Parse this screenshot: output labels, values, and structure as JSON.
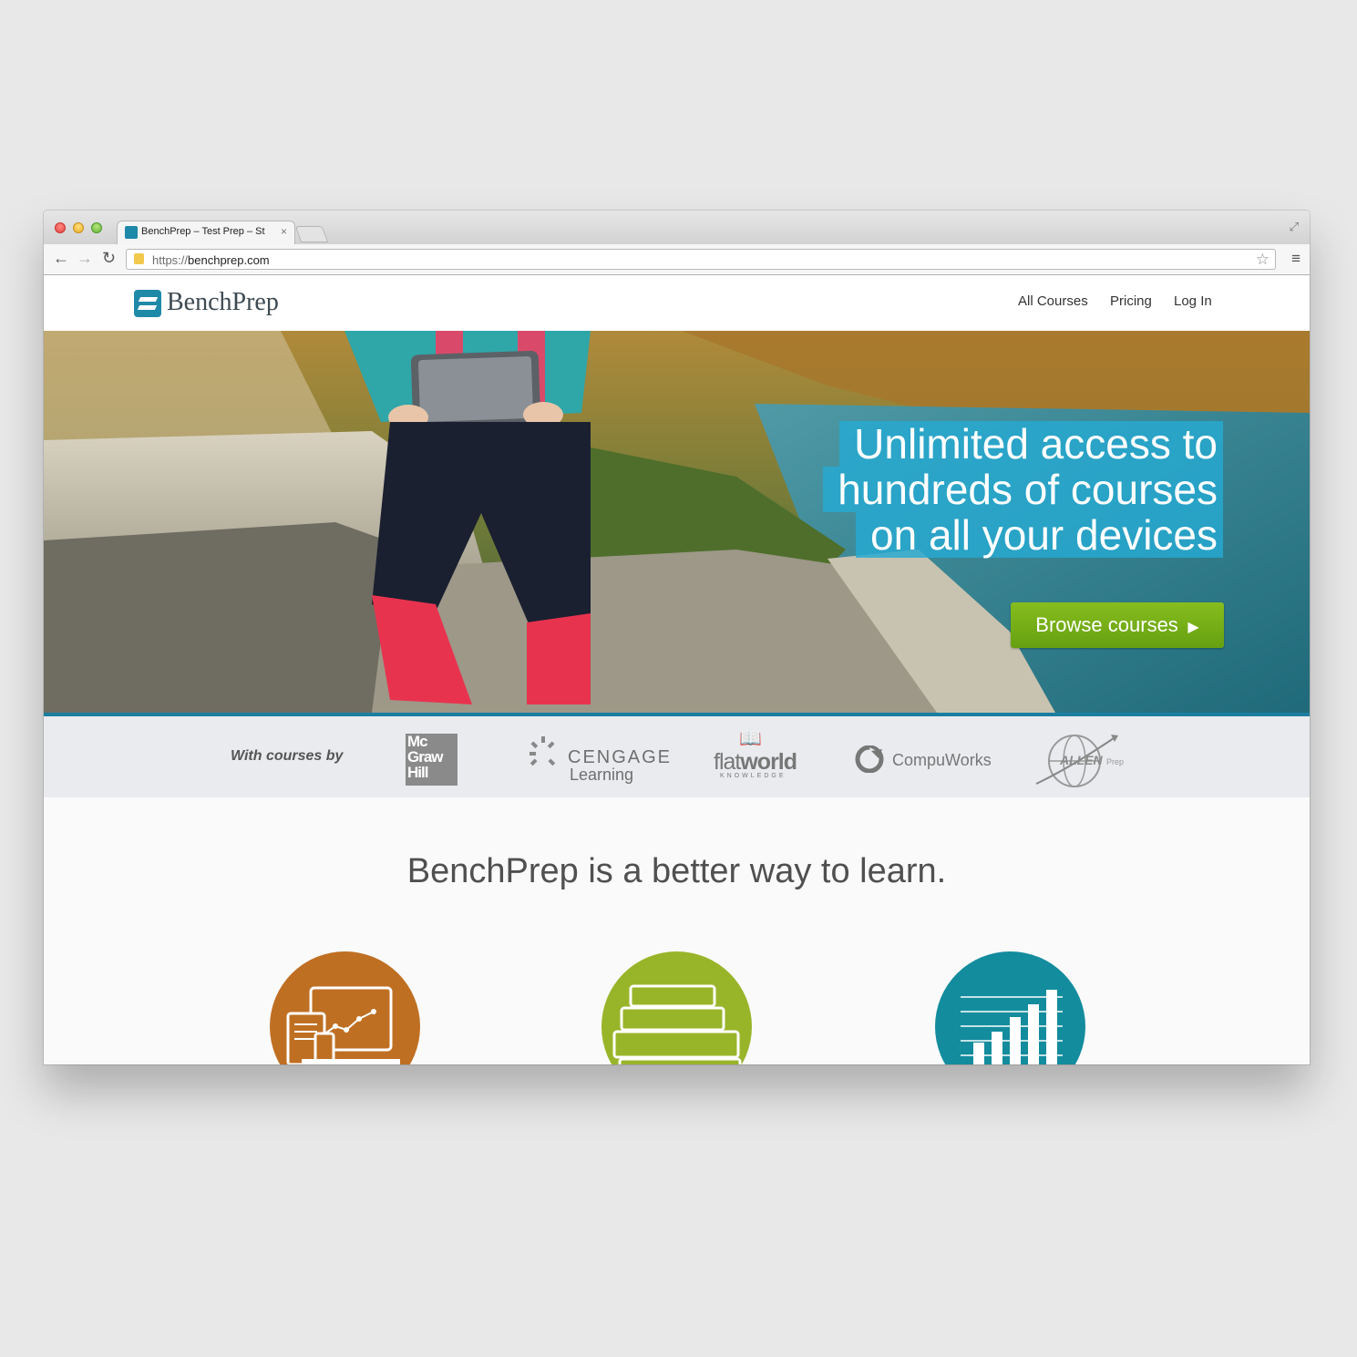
{
  "browser": {
    "tab_title": "BenchPrep – Test Prep – St",
    "tab_close": "×",
    "url_scheme": "https://",
    "url_host": "benchprep.com",
    "icons": [
      "back-icon",
      "forward-icon",
      "reload-icon",
      "lock-icon",
      "star-icon",
      "menu-icon",
      "fullscreen-icon"
    ]
  },
  "header": {
    "logo_text": "BenchPrep",
    "nav": [
      {
        "label": "All Courses"
      },
      {
        "label": "Pricing"
      },
      {
        "label": "Log In"
      }
    ]
  },
  "hero": {
    "headline_lines": [
      "Unlimited access to",
      "hundreds of courses",
      "on all your devices"
    ],
    "cta_label": "Browse courses",
    "cta_icon": "triangle-right-icon",
    "accent_color": "#26aad2",
    "cta_color": "#7ab51a"
  },
  "partners": {
    "label": "With courses by",
    "logos": [
      {
        "name": "McGraw Hill",
        "lines": [
          "Mc",
          "Graw",
          "Hill"
        ]
      },
      {
        "name": "Cengage Learning",
        "line1": "CENGAGE",
        "line2": "Learning"
      },
      {
        "name": "Flat World Knowledge",
        "text_light": "flat",
        "text_bold": "world",
        "sub": "KNOWLEDGE"
      },
      {
        "name": "CompuWorks",
        "text": "CompuWorks"
      },
      {
        "name": "Allen Prep",
        "text": "ALLEN",
        "sub": "Prep"
      }
    ]
  },
  "features": {
    "tagline": "BenchPrep is a better way to learn.",
    "circles": [
      {
        "icon": "devices-icon",
        "color": "#bf6f22"
      },
      {
        "icon": "books-icon",
        "color": "#98b52a"
      },
      {
        "icon": "bar-chart-icon",
        "color": "#138c9d"
      }
    ]
  }
}
